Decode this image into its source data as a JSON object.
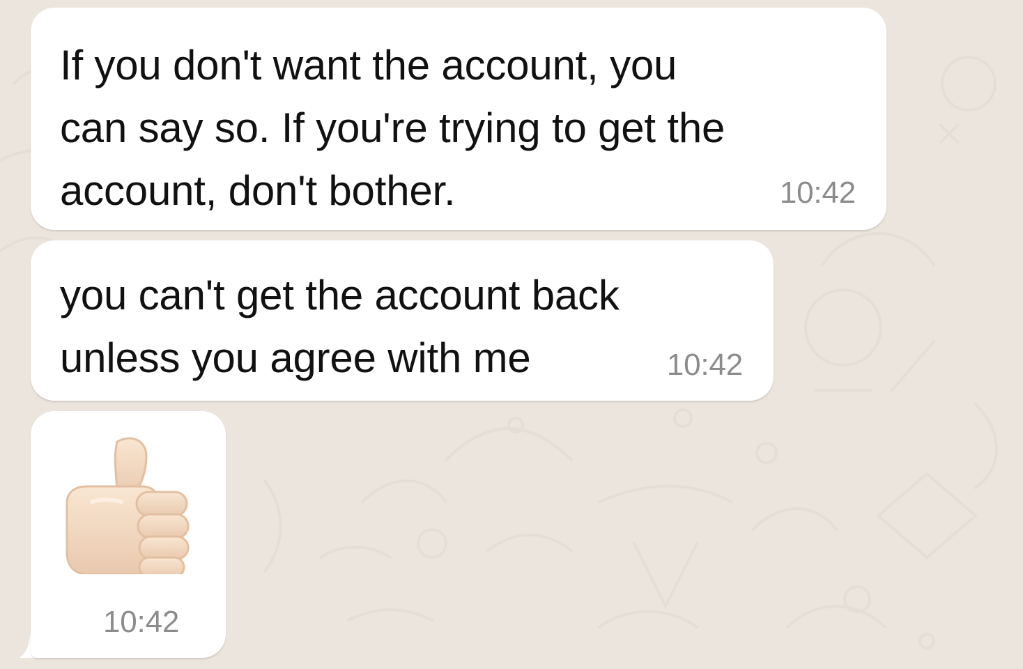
{
  "messages": [
    {
      "text": "If you don't want the account, you\ncan say so. If you're trying to get the\naccount, don't bother.",
      "time": "10:42"
    },
    {
      "text": "you can't get the account back\nunless you agree with me",
      "time": "10:42"
    },
    {
      "emoji": "thumbs-up-icon",
      "time": "10:42"
    }
  ],
  "colors": {
    "background": "#ECE5DD",
    "bubble": "#FFFFFF",
    "time": "#8C8C8C"
  }
}
